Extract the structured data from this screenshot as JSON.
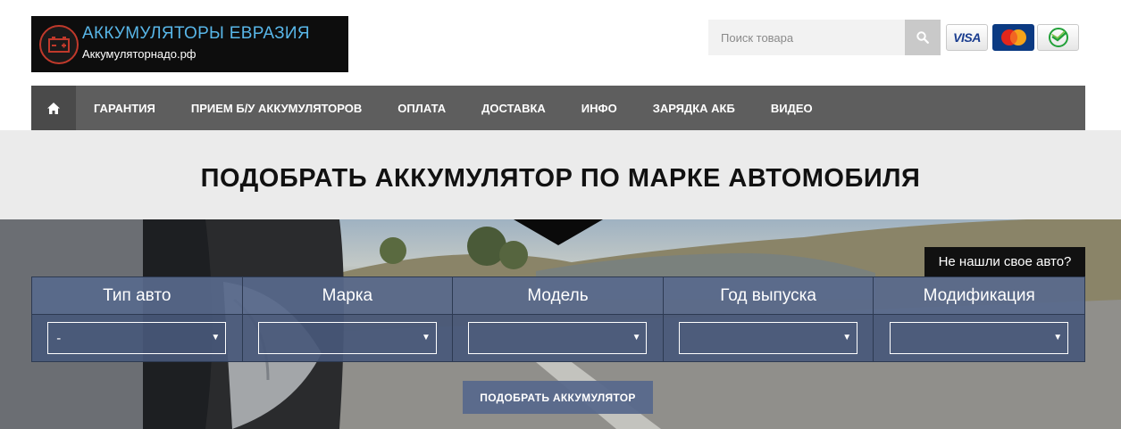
{
  "brand": {
    "title": "АККУМУЛЯТОРЫ ЕВРАЗИЯ",
    "subtitle": "Аккумуляторнадо.рф",
    "icon": "battery-icon"
  },
  "search": {
    "placeholder": "Поиск товара",
    "icon": "search-icon"
  },
  "payments": {
    "visa": "VISA",
    "mastercard": "MasterCard",
    "sberbank_icon": "sberbank-icon"
  },
  "nav": {
    "home_icon": "home-icon",
    "items": [
      {
        "label": "ГАРАНТИЯ"
      },
      {
        "label": "ПРИЕМ Б/У АККУМУЛЯТОРОВ"
      },
      {
        "label": "ОПЛАТА"
      },
      {
        "label": "ДОСТАВКА"
      },
      {
        "label": "ИНФО"
      },
      {
        "label": "ЗАРЯДКА АКБ"
      },
      {
        "label": "ВИДЕО"
      }
    ]
  },
  "selector": {
    "heading": "ПОДОБРАТЬ АККУМУЛЯТОР ПО МАРКЕ АВТОМОБИЛЯ",
    "not_found": "Не нашли свое авто?",
    "columns": [
      {
        "label": "Тип авто",
        "value": "-"
      },
      {
        "label": "Марка",
        "value": ""
      },
      {
        "label": "Модель",
        "value": ""
      },
      {
        "label": "Год выпуска",
        "value": ""
      },
      {
        "label": "Модификация",
        "value": ""
      }
    ],
    "submit": "ПОДОБРАТЬ АККУМУЛЯТОР"
  },
  "colors": {
    "nav_bg": "#5e5e5e",
    "brand_title": "#58b6e8",
    "picker_bg": "#58698c"
  }
}
